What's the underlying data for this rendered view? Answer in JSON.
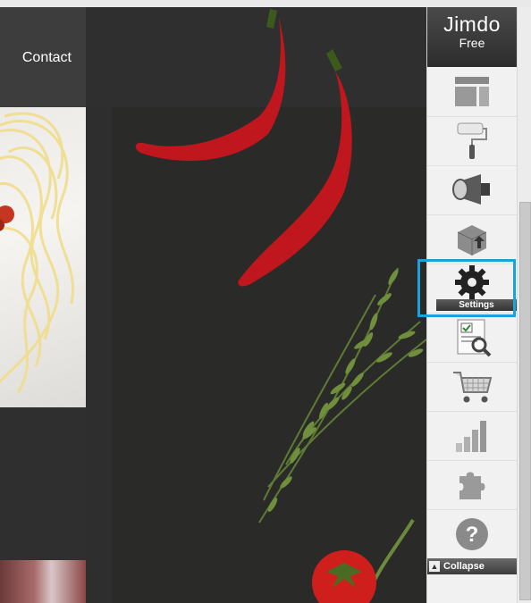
{
  "site": {
    "nav": {
      "contact_label": "Contact"
    }
  },
  "jimdo_panel": {
    "brand": "Jimdo",
    "plan": "Free",
    "tools": [
      {
        "icon": "layout-icon",
        "label": ""
      },
      {
        "icon": "paint-roller-icon",
        "label": ""
      },
      {
        "icon": "megaphone-icon",
        "label": ""
      },
      {
        "icon": "upload-box-icon",
        "label": ""
      },
      {
        "icon": "gear-icon",
        "label": "Settings"
      },
      {
        "icon": "seo-report-icon",
        "label": ""
      },
      {
        "icon": "shopping-cart-icon",
        "label": ""
      },
      {
        "icon": "statistics-bars-icon",
        "label": ""
      },
      {
        "icon": "puzzle-icon",
        "label": ""
      },
      {
        "icon": "help-icon",
        "label": ""
      }
    ],
    "collapse_label": "Collapse",
    "highlight_color": "#1aa3d9"
  }
}
